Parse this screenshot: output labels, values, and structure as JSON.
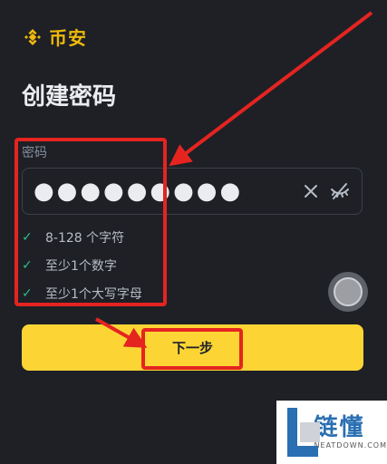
{
  "brand": {
    "name": "币安",
    "logo_icon": "binance-diamond-icon",
    "color": "#f0b90b"
  },
  "page": {
    "title": "创建密码"
  },
  "password_field": {
    "label": "密码",
    "value": "●●●●●●●●●",
    "clear_icon": "close-icon",
    "visibility_icon": "eye-off-icon"
  },
  "rules": [
    {
      "text": "8-128 个字符",
      "icon": "check-icon"
    },
    {
      "text": "至少1个数字",
      "icon": "check-icon"
    },
    {
      "text": "至少1个大写字母",
      "icon": "check-icon"
    }
  ],
  "next_button": {
    "label": "下一步",
    "color": "#fcd535"
  },
  "annotation": {
    "color": "#e52420"
  },
  "watermark": {
    "name": "链懂",
    "site": "NEATDOWN.COM"
  }
}
